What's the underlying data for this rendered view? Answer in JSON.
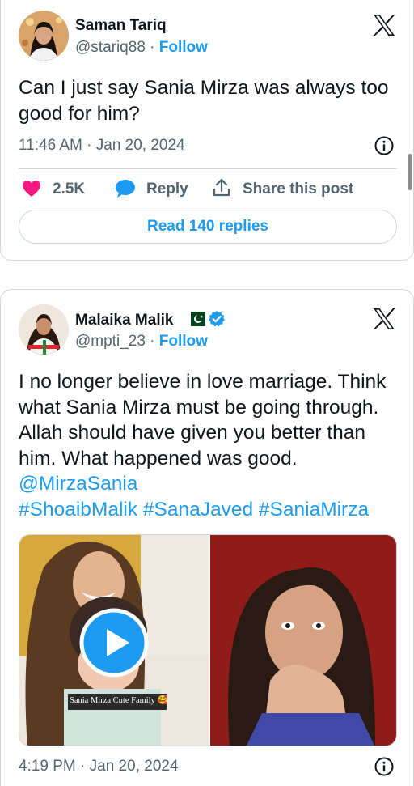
{
  "tweets": [
    {
      "author": "Saman Tariq",
      "handle": "@stariq88",
      "separator": "·",
      "follow_label": "Follow",
      "text": "Can I just say Sania Mirza was always too good for him?",
      "timestamp": "11:46 AM · Jan 20, 2024",
      "likes": "2.5K",
      "reply_label": "Reply",
      "share_label": "Share this post",
      "read_replies_label": "Read 140 replies",
      "icons": [
        "avatar",
        "x-logo-icon",
        "info-icon",
        "heart-icon",
        "reply-bubble-icon",
        "share-icon"
      ],
      "colors": {
        "heart": "#f91880",
        "link": "#1d9bf0",
        "secondary_text": "#536471"
      }
    },
    {
      "author": "Malaika Malik",
      "handle": "@mpti_23",
      "separator": "·",
      "follow_label": "Follow",
      "text_plain": "I no longer believe in love marriage. Think what Sania Mirza must be going through. Allah should have given you better than him. What happened was good. ",
      "mention": "@MirzaSania",
      "hashtags": "#ShoaibMalik #SanaJaved #SaniaMirza",
      "media_caption": "Sania Mirza Cute Family 🥰",
      "timestamp": "4:19 PM · Jan 20, 2024",
      "icons": [
        "avatar",
        "pakistan-flag-icon",
        "verified-badge-icon",
        "x-logo-icon",
        "play-icon",
        "info-icon"
      ],
      "colors": {
        "verified": "#1d9bf0",
        "flag_green": "#01411c"
      }
    }
  ]
}
